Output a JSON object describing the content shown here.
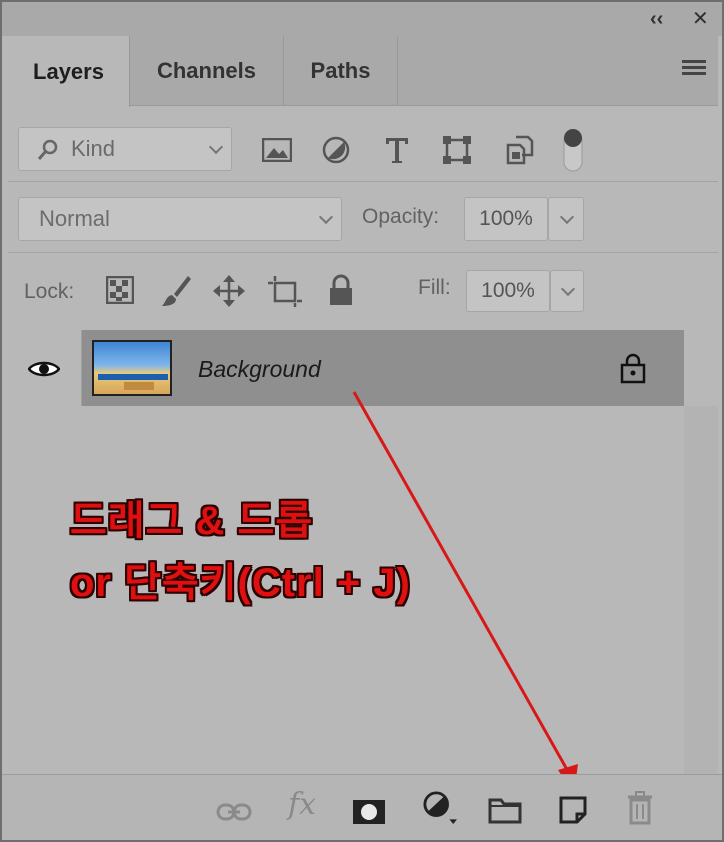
{
  "window": {
    "collapse_glyph": "‹‹",
    "close_glyph": "✕"
  },
  "tabs": [
    {
      "label": "Layers",
      "active": true
    },
    {
      "label": "Channels",
      "active": false
    },
    {
      "label": "Paths",
      "active": false
    }
  ],
  "filter": {
    "kind_label": "Kind",
    "icons": [
      "image-filter-icon",
      "adjustment-filter-icon",
      "type-filter-icon",
      "shape-filter-icon",
      "smart-object-filter-icon",
      "filter-toggle-icon"
    ]
  },
  "blend": {
    "mode": "Normal",
    "opacity_label": "Opacity:",
    "opacity_value": "100%"
  },
  "lock": {
    "label": "Lock:",
    "icons": [
      "lock-transparent-pixels-icon",
      "lock-image-pixels-icon",
      "lock-position-icon",
      "lock-artboard-icon",
      "lock-all-icon"
    ],
    "fill_label": "Fill:",
    "fill_value": "100%"
  },
  "layers": [
    {
      "name": "Background",
      "visible": true,
      "locked": true
    }
  ],
  "annotation": {
    "line1": "드래그 & 드롭",
    "line2": "or 단축키(Ctrl + J)",
    "color": "#e01010"
  },
  "footer": {
    "fx_label": "fx",
    "icons": [
      "link-layers-icon",
      "fx-icon",
      "add-mask-icon",
      "new-adjustment-layer-icon",
      "new-group-icon",
      "new-layer-icon",
      "delete-layer-icon"
    ]
  }
}
